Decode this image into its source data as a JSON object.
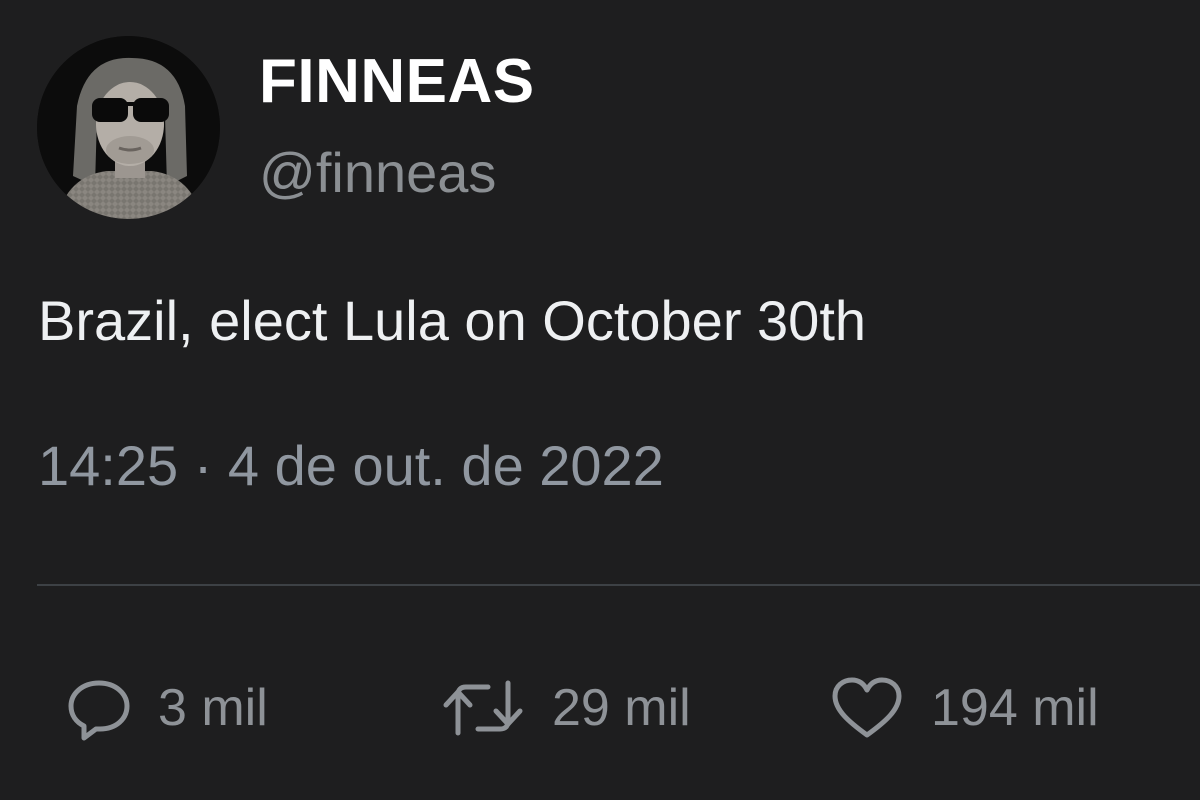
{
  "user": {
    "display_name": "FINNEAS",
    "handle": "@finneas"
  },
  "tweet": {
    "text": "Brazil, elect Lula on October 30th",
    "timestamp": "14:25 · 4 de out. de 2022"
  },
  "actions": {
    "replies": {
      "icon": "reply-icon",
      "count": "3 mil"
    },
    "retweets": {
      "icon": "retweet-icon",
      "count": "29 mil"
    },
    "likes": {
      "icon": "heart-icon",
      "count": "194 mil"
    }
  },
  "colors": {
    "background": "#1e1e1f",
    "name": "#ffffff",
    "handle": "#8b8f93",
    "text": "#eef0f2",
    "meta": "#9097a0",
    "icon": "#8e9297"
  }
}
